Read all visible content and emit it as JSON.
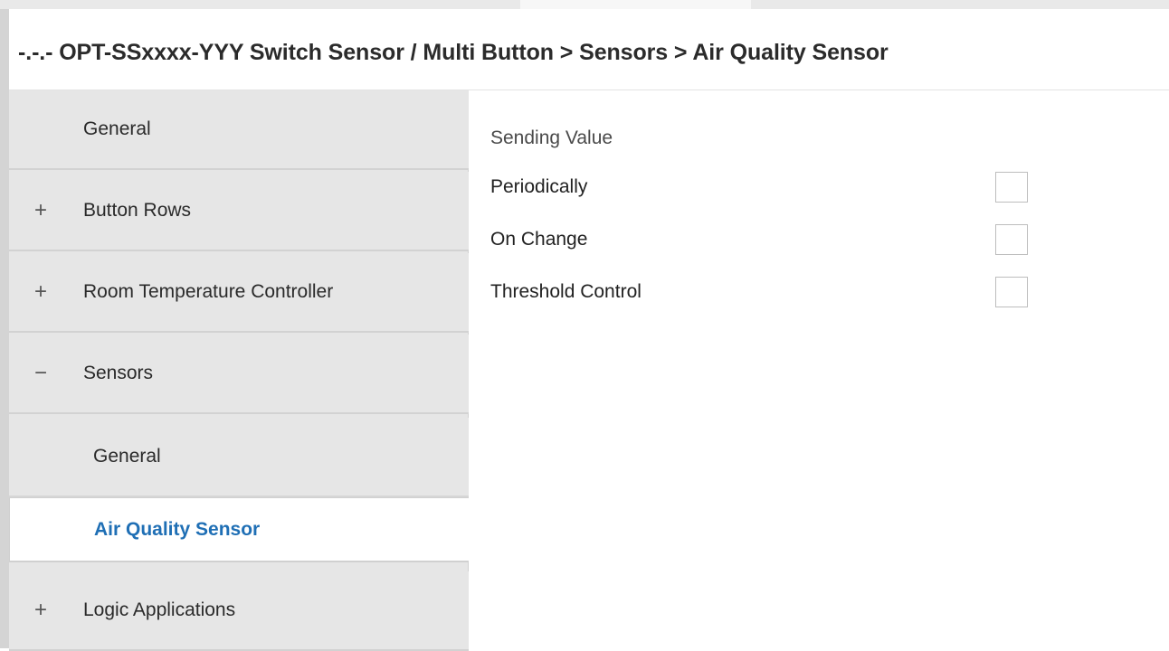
{
  "header": {
    "title": "-.-.- OPT-SSxxxx-YYY Switch Sensor / Multi Button > Sensors > Air Quality Sensor"
  },
  "sidebar": {
    "items": [
      {
        "sign": "",
        "label": "General"
      },
      {
        "sign": "+",
        "label": "Button Rows"
      },
      {
        "sign": "+",
        "label": "Room Temperature Controller"
      },
      {
        "sign": "−",
        "label": "Sensors"
      },
      {
        "sign": "+",
        "label": "Logic Applications"
      }
    ],
    "sub_items": [
      {
        "label": "General"
      },
      {
        "label": "Air Quality Sensor"
      }
    ]
  },
  "content": {
    "section_label": "Sending Value",
    "rows": [
      {
        "label": "Periodically",
        "checked": false
      },
      {
        "label": "On Change",
        "checked": false
      },
      {
        "label": "Threshold Control",
        "checked": false
      }
    ]
  },
  "colors": {
    "active_link": "#1f6fb5",
    "sidebar_bg": "#e6e6e6"
  }
}
